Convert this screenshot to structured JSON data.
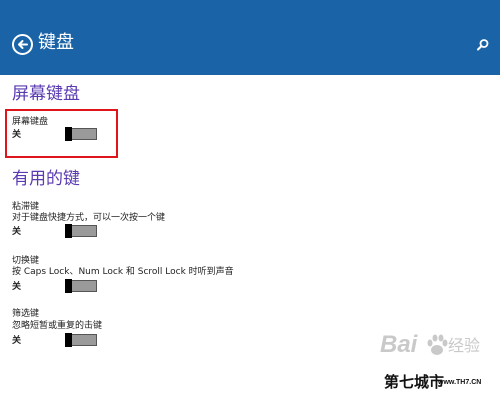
{
  "header": {
    "title": "键盘",
    "back_icon": "back-arrow-circle-icon",
    "search_icon": "search-icon",
    "color": "#1a63a7"
  },
  "screen_keyboard": {
    "section_title": "屏幕键盘",
    "setting_label": "屏幕键盘",
    "state": "关",
    "toggle_on": false
  },
  "useful_keys": {
    "section_title": "有用的键",
    "items": [
      {
        "label": "粘滞键",
        "description": "对于键盘快捷方式，可以一次按一个键",
        "state": "关",
        "toggle_on": false
      },
      {
        "label": "切换键",
        "description": "按 Caps Lock、Num Lock 和 Scroll Lock 时听到声音",
        "state": "关",
        "toggle_on": false
      },
      {
        "label": "筛选键",
        "description": "忽略短暂或重复的击键",
        "state": "关",
        "toggle_on": false
      }
    ]
  },
  "annotation": {
    "highlight_color": "#e0141b"
  },
  "watermark": {
    "brand": "Bai",
    "brand_product": "经验",
    "site_name": "第七城市",
    "site_url": "www.TH7.CN"
  }
}
